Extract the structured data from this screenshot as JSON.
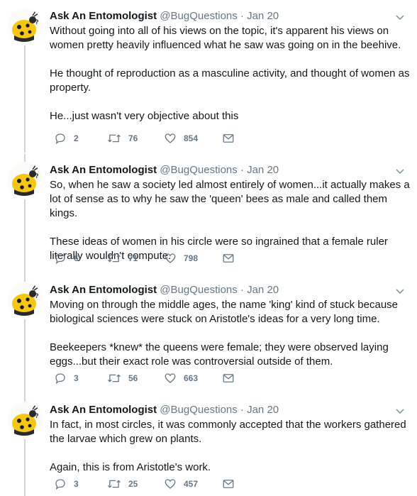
{
  "tweets": [
    {
      "name": "Ask An Entomologist",
      "handle": "@BugQuestions",
      "separator": "·",
      "date": "Jan 20",
      "paragraphs": [
        "Without going into all of his views on the topic, it's apparent his views on women pretty heavily influenced what he saw was going on in the beehive.",
        "He thought of reproduction as a masculine activity, and thought of women as property.",
        "He...just wasn't very objective about this"
      ],
      "replies": "2",
      "retweets": "76",
      "likes": "854"
    },
    {
      "name": "Ask An Entomologist",
      "handle": "@BugQuestions",
      "separator": "·",
      "date": "Jan 20",
      "paragraphs": [
        "So, when he saw a society led almost entirely of women...it actually makes a lot of sense as to why he saw the 'queen' bees as male and called them kings.",
        "These ideas of women in his circle were so ingrained that a female ruler literally wouldn't compute."
      ],
      "replies": "6",
      "retweets": "71",
      "likes": "798"
    },
    {
      "name": "Ask An Entomologist",
      "handle": "@BugQuestions",
      "separator": "·",
      "date": "Jan 20",
      "paragraphs": [
        "Moving on through the middle ages, the name 'king' kind of stuck because biological sciences were stuck on Aristotle's ideas for a very long time.",
        "Beekeepers *knew* the queens were female; they were observed laying eggs...but their exact role was controversial outside of them."
      ],
      "replies": "3",
      "retweets": "56",
      "likes": "663"
    },
    {
      "name": "Ask An Entomologist",
      "handle": "@BugQuestions",
      "separator": "·",
      "date": "Jan 20",
      "paragraphs": [
        "In fact, in most circles, it was commonly accepted that the workers gathered the larvae which grew on plants.",
        "Again, this is from Aristotle's work."
      ],
      "replies": "3",
      "retweets": "25",
      "likes": "457"
    }
  ],
  "icons": {
    "reply": "reply-icon",
    "retweet": "retweet-icon",
    "like": "heart-icon",
    "message": "envelope-icon",
    "caret": "chevron-down-icon"
  },
  "colors": {
    "name": "#14171a",
    "meta": "#657786",
    "thread_line": "#ccd6dd",
    "avatar_bg": "#f5c518"
  }
}
